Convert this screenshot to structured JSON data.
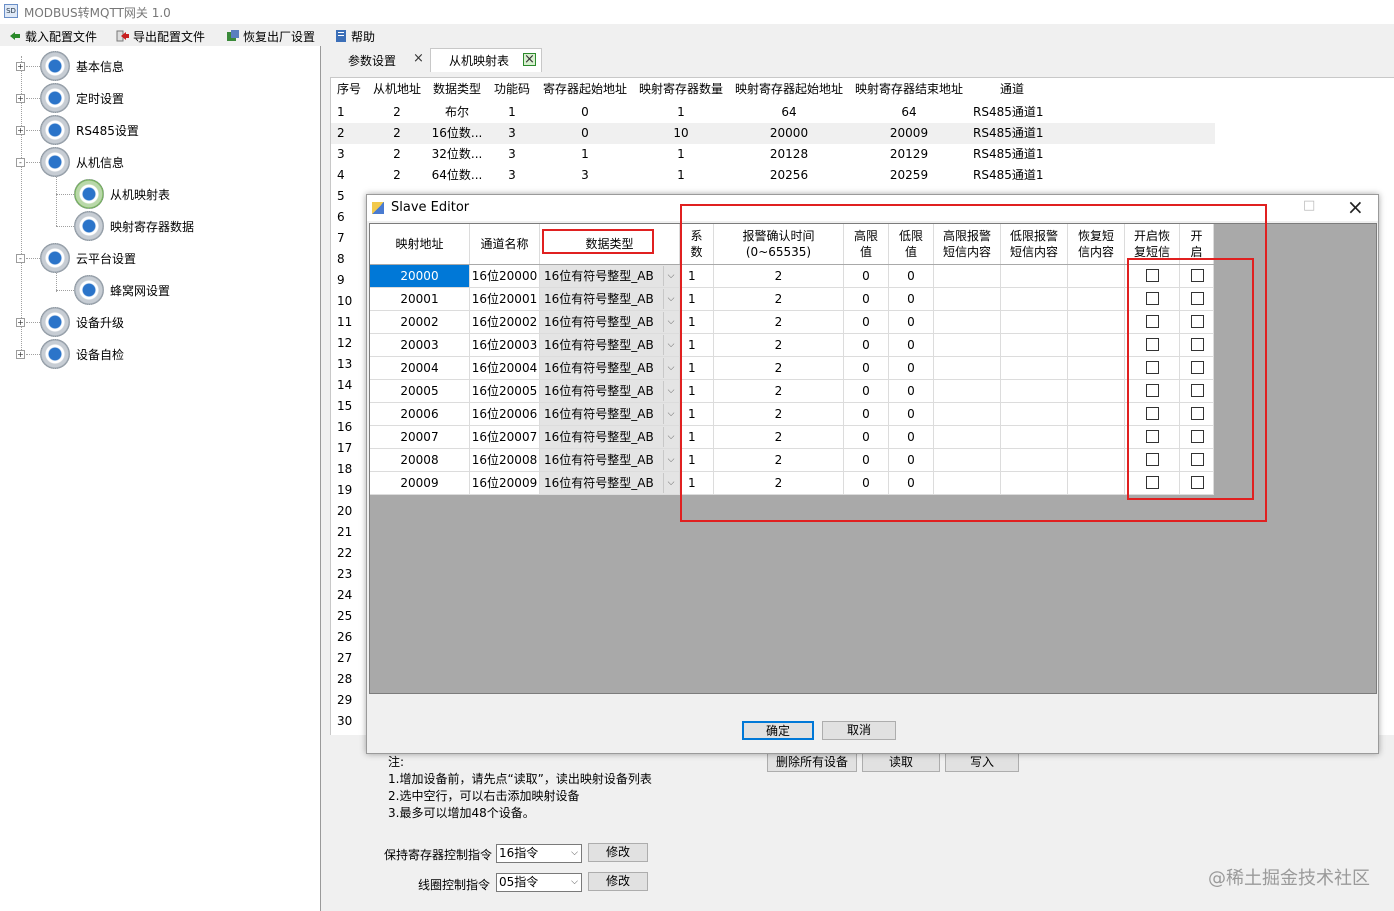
{
  "window": {
    "title": "MODBUS转MQTT网关 1.0",
    "app_icon_text": "SD"
  },
  "menu": [
    {
      "label": "载入配置文件",
      "icon": "load-arrow-icon"
    },
    {
      "label": "导出配置文件",
      "icon": "export-arrow-icon"
    },
    {
      "label": "恢复出厂设置",
      "icon": "restore-icon"
    },
    {
      "label": "帮助",
      "icon": "help-icon"
    }
  ],
  "tree": {
    "nodes": [
      {
        "label": "基本信息",
        "expander": "+"
      },
      {
        "label": "定时设置",
        "expander": "+"
      },
      {
        "label": "RS485设置",
        "expander": "+"
      },
      {
        "label": "从机信息",
        "expander": "-"
      },
      {
        "label": "从机映射表",
        "child": true
      },
      {
        "label": "映射寄存器数据",
        "child": true
      },
      {
        "label": "云平台设置",
        "expander": "-"
      },
      {
        "label": "蜂窝网设置",
        "child": true
      },
      {
        "label": "设备升级",
        "expander": "+"
      },
      {
        "label": "设备自检",
        "expander": "+"
      }
    ]
  },
  "tabs": [
    {
      "label": "参数设置",
      "close": "×"
    },
    {
      "label": "从机映射表",
      "close": "×"
    }
  ],
  "mapping_table": {
    "headers": [
      "序号",
      "从机地址",
      "数据类型",
      "功能码",
      "寄存器起始地址",
      "映射寄存器数量",
      "映射寄存器起始地址",
      "映射寄存器结束地址",
      "通道"
    ],
    "rows": [
      [
        "1",
        "2",
        "布尔",
        "1",
        "0",
        "1",
        "64",
        "64",
        "RS485通道1"
      ],
      [
        "2",
        "2",
        "16位数...",
        "3",
        "0",
        "10",
        "20000",
        "20009",
        "RS485通道1"
      ],
      [
        "3",
        "2",
        "32位数...",
        "3",
        "1",
        "1",
        "20128",
        "20129",
        "RS485通道1"
      ],
      [
        "4",
        "2",
        "64位数...",
        "3",
        "3",
        "1",
        "20256",
        "20259",
        "RS485通道1"
      ]
    ],
    "row_numbers": [
      "5",
      "6",
      "7",
      "8",
      "9",
      "10",
      "11",
      "12",
      "13",
      "14",
      "15",
      "16",
      "17",
      "18",
      "19",
      "20",
      "21",
      "22",
      "23",
      "24",
      "25",
      "26",
      "27",
      "28",
      "29",
      "30"
    ]
  },
  "bottom": {
    "notes": [
      "注:",
      "1.增加设备前，请先点“读取”，读出映射设备列表",
      "2.选中空行，可以右击添加映射设备",
      "3.最多可以增加48个设备。"
    ],
    "buttons": {
      "delete_all": "删除所有设备",
      "read": "读取",
      "write": "写入"
    },
    "holding_label": "保持寄存器控制指令",
    "holding_value": "16指令",
    "coil_label": "线圈控制指令",
    "coil_value": "05指令",
    "modify": "修改"
  },
  "dialog": {
    "title": "Slave Editor",
    "headers": [
      "映射地址",
      "通道名称",
      "数据类型",
      "系数",
      "报警确认时间(0~65535)",
      "高限值",
      "低限值",
      "高限报警短信内容",
      "低限报警短信内容",
      "恢复短信内容",
      "开启恢复短信",
      "开启"
    ],
    "header_lines": [
      [
        "映射地址"
      ],
      [
        "通道名称"
      ],
      [
        "数据类型"
      ],
      [
        "系",
        "数"
      ],
      [
        "报警确认时间",
        "(0~65535)"
      ],
      [
        "高限",
        "值"
      ],
      [
        "低限",
        "值"
      ],
      [
        "高限报警",
        "短信内容"
      ],
      [
        "低限报警",
        "短信内容"
      ],
      [
        "恢复短",
        "信内容"
      ],
      [
        "开启恢",
        "复短信"
      ],
      [
        "开",
        "启"
      ]
    ],
    "rows": [
      {
        "addr": "20000",
        "name": "16位20000",
        "type": "16位有符号整型_AB",
        "coef": "1",
        "confirm": "2",
        "high": "0",
        "low": "0"
      },
      {
        "addr": "20001",
        "name": "16位20001",
        "type": "16位有符号整型_AB",
        "coef": "1",
        "confirm": "2",
        "high": "0",
        "low": "0"
      },
      {
        "addr": "20002",
        "name": "16位20002",
        "type": "16位有符号整型_AB",
        "coef": "1",
        "confirm": "2",
        "high": "0",
        "low": "0"
      },
      {
        "addr": "20003",
        "name": "16位20003",
        "type": "16位有符号整型_AB",
        "coef": "1",
        "confirm": "2",
        "high": "0",
        "low": "0"
      },
      {
        "addr": "20004",
        "name": "16位20004",
        "type": "16位有符号整型_AB",
        "coef": "1",
        "confirm": "2",
        "high": "0",
        "low": "0"
      },
      {
        "addr": "20005",
        "name": "16位20005",
        "type": "16位有符号整型_AB",
        "coef": "1",
        "confirm": "2",
        "high": "0",
        "low": "0"
      },
      {
        "addr": "20006",
        "name": "16位20006",
        "type": "16位有符号整型_AB",
        "coef": "1",
        "confirm": "2",
        "high": "0",
        "low": "0"
      },
      {
        "addr": "20007",
        "name": "16位20007",
        "type": "16位有符号整型_AB",
        "coef": "1",
        "confirm": "2",
        "high": "0",
        "low": "0"
      },
      {
        "addr": "20008",
        "name": "16位20008",
        "type": "16位有符号整型_AB",
        "coef": "1",
        "confirm": "2",
        "high": "0",
        "low": "0"
      },
      {
        "addr": "20009",
        "name": "16位20009",
        "type": "16位有符号整型_AB",
        "coef": "1",
        "confirm": "2",
        "high": "0",
        "low": "0"
      }
    ],
    "ok": "确定",
    "cancel": "取消",
    "close_glyph": "×",
    "maximize_glyph": "□",
    "dropdown_glyph": "⌵"
  },
  "watermark": "@稀土掘金技术社区",
  "colors": {
    "selection": "#0078d7",
    "highlight_box": "#e02020",
    "grid_empty": "#a9a9a9"
  }
}
